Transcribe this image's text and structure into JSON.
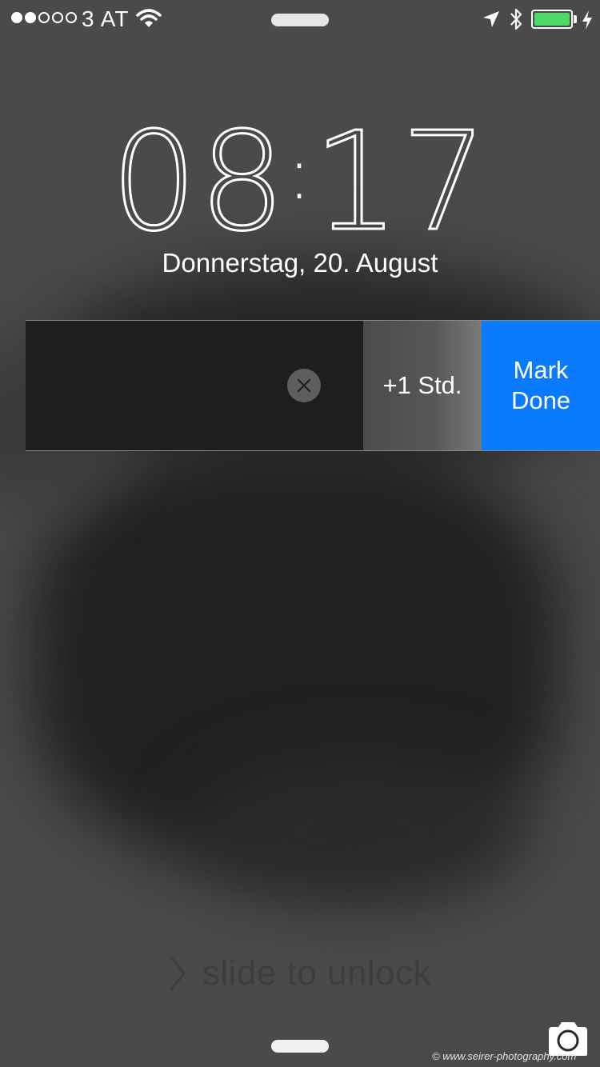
{
  "status_bar": {
    "signal_filled": 2,
    "signal_total": 5,
    "carrier": "3 AT",
    "battery_level": 1.0,
    "battery_color": "#4cd964",
    "icons": [
      "wifi-icon",
      "location-arrow-icon",
      "bluetooth-icon",
      "battery-icon",
      "charging-bolt-icon"
    ]
  },
  "lock_screen": {
    "time_hours": "08",
    "time_minutes": "17",
    "time_separator": ":",
    "date": "Donnerstag, 20. August"
  },
  "notification": {
    "clear_icon": "close-icon",
    "snooze_label": "+1 Std.",
    "done_label_line1": "Mark",
    "done_label_line2": "Done",
    "done_color": "#0a7aff"
  },
  "unlock": {
    "text": "slide to unlock"
  },
  "footer": {
    "camera_icon": "camera-icon",
    "watermark": "© www.seirer-photography.com"
  }
}
